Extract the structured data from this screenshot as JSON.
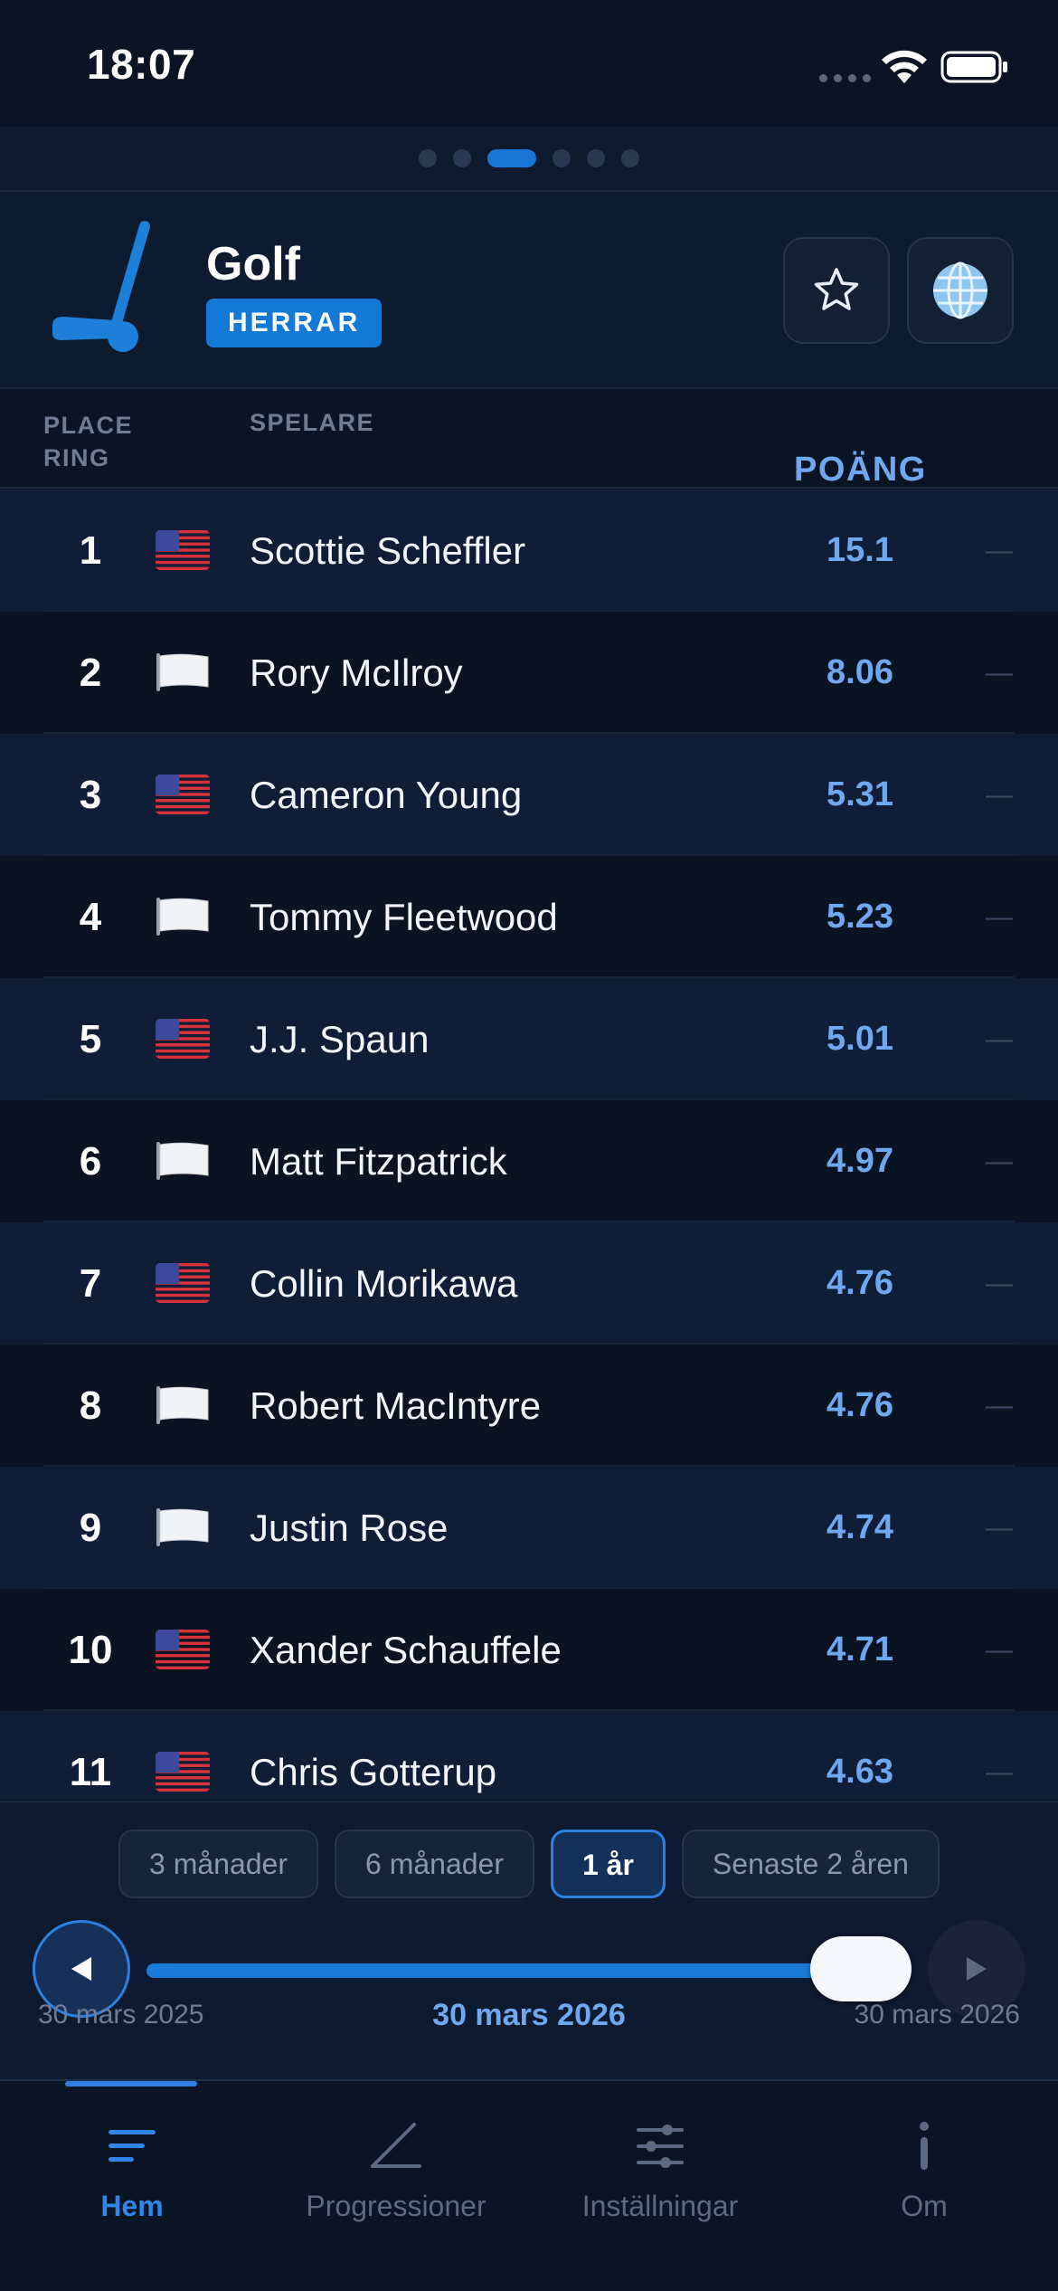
{
  "status_bar": {
    "time": "18:07"
  },
  "header": {
    "title": "Golf",
    "badge": "HERRAR",
    "icon": "golf-club-icon"
  },
  "columns": {
    "rank": "PLACE RING",
    "player": "SPELARE",
    "points": "POÄNG"
  },
  "rankings": [
    {
      "rank": "1",
      "flag": "us",
      "name": "Scottie Scheffler",
      "points": "15.1",
      "change": "—"
    },
    {
      "rank": "2",
      "flag": "white",
      "name": "Rory McIlroy",
      "points": "8.06",
      "change": "—"
    },
    {
      "rank": "3",
      "flag": "us",
      "name": "Cameron Young",
      "points": "5.31",
      "change": "—"
    },
    {
      "rank": "4",
      "flag": "white",
      "name": "Tommy Fleetwood",
      "points": "5.23",
      "change": "—"
    },
    {
      "rank": "5",
      "flag": "us",
      "name": "J.J. Spaun",
      "points": "5.01",
      "change": "—"
    },
    {
      "rank": "6",
      "flag": "white",
      "name": "Matt Fitzpatrick",
      "points": "4.97",
      "change": "—"
    },
    {
      "rank": "7",
      "flag": "us",
      "name": "Collin Morikawa",
      "points": "4.76",
      "change": "—"
    },
    {
      "rank": "8",
      "flag": "white",
      "name": "Robert MacIntyre",
      "points": "4.76",
      "change": "—"
    },
    {
      "rank": "9",
      "flag": "white",
      "name": "Justin Rose",
      "points": "4.74",
      "change": "—"
    },
    {
      "rank": "10",
      "flag": "us",
      "name": "Xander Schauffele",
      "points": "4.71",
      "change": "—"
    },
    {
      "rank": "11",
      "flag": "us",
      "name": "Chris Gotterup",
      "points": "4.63",
      "change": "—"
    }
  ],
  "periods": [
    {
      "label": "3 månader",
      "active": false
    },
    {
      "label": "6 månader",
      "active": false
    },
    {
      "label": "1 år",
      "active": true
    },
    {
      "label": "Senaste 2 åren",
      "active": false
    }
  ],
  "timeline": {
    "start": "30 mars 2025",
    "current": "30 mars 2026",
    "end": "30 mars 2026",
    "position": 1.0
  },
  "tabs": [
    {
      "label": "Hem",
      "icon": "home-lines-icon",
      "active": true
    },
    {
      "label": "Progressioner",
      "icon": "progression-icon",
      "active": false
    },
    {
      "label": "Inställningar",
      "icon": "sliders-icon",
      "active": false
    },
    {
      "label": "Om",
      "icon": "info-icon",
      "active": false
    }
  ],
  "colors": {
    "accent": "#1877d6",
    "background": "#0b1424",
    "points": "#6fa8f0"
  }
}
